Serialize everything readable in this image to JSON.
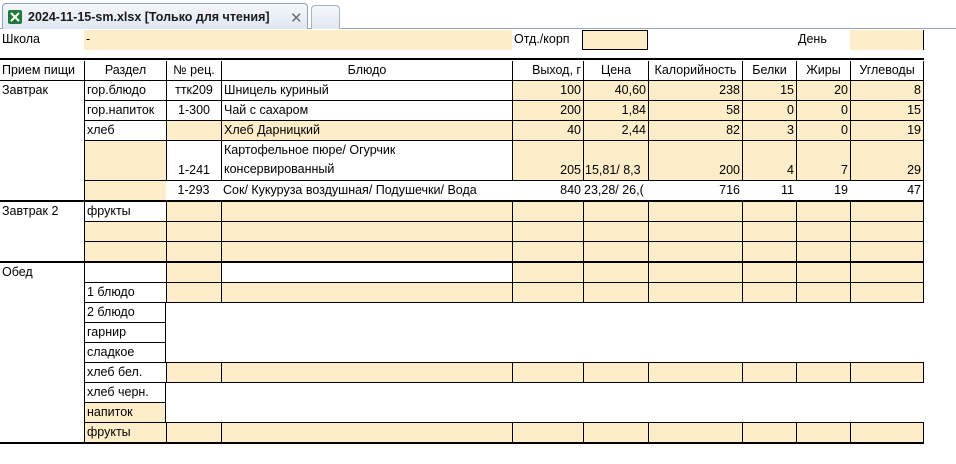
{
  "tab": {
    "icon": "excel-file-icon",
    "title": "2024-11-15-sm.xlsx  [Только для чтения]",
    "close_glyph": "✕"
  },
  "header_row": {
    "school_label": "Школа",
    "school_value": "-",
    "dept_label": "Отд./корп",
    "dept_value": "",
    "day_label": "День",
    "day_value": ""
  },
  "columns": [
    "Прием пищи",
    "Раздел",
    "№ рец.",
    "Блюдо",
    "Выход, г",
    "Цена",
    "Калорийность",
    "Белки",
    "Жиры",
    "Углеводы"
  ],
  "meals": {
    "breakfast": "Завтрак",
    "breakfast2": "Завтрак 2",
    "lunch": "Обед"
  },
  "breakfast_rows": [
    {
      "section": "гор.блюдо",
      "recipe": "ттк209",
      "dish": "Шницель куриный",
      "yield": "100",
      "price": "40,60",
      "kcal": "238",
      "protein": "15",
      "fat": "20",
      "carbs": "8"
    },
    {
      "section": "гор.напиток",
      "recipe": "1-300",
      "dish": "Чай с сахаром",
      "yield": "200",
      "price": "1,84",
      "kcal": "58",
      "protein": "0",
      "fat": "0",
      "carbs": "15"
    },
    {
      "section": "хлеб",
      "recipe": "",
      "dish": "Хлеб Дарницкий",
      "yield": "40",
      "price": "2,44",
      "kcal": "82",
      "protein": "3",
      "fat": "0",
      "carbs": "19"
    },
    {
      "section": "",
      "recipe": "1-241",
      "dish_line1": "Картофельное пюре/ Огурчик",
      "dish_line2": "консервированный",
      "yield": "205",
      "price": "15,81/ 8,3",
      "kcal": "200",
      "protein": "4",
      "fat": "7",
      "carbs": "29"
    },
    {
      "section": "",
      "recipe": "1-293",
      "dish": "Сок/ Кукуруза воздушная/ Подушечки/ Вода",
      "yield": "840",
      "price": "23,28/ 26,(",
      "kcal": "716",
      "protein": "11",
      "fat": "19",
      "carbs": "47"
    }
  ],
  "breakfast2_rows": [
    {
      "section": "фрукты"
    }
  ],
  "lunch_sections": [
    "1 блюдо",
    "2 блюдо",
    "гарнир",
    "сладкое",
    "хлеб бел.",
    "хлеб черн.",
    "напиток",
    "фрукты"
  ]
}
